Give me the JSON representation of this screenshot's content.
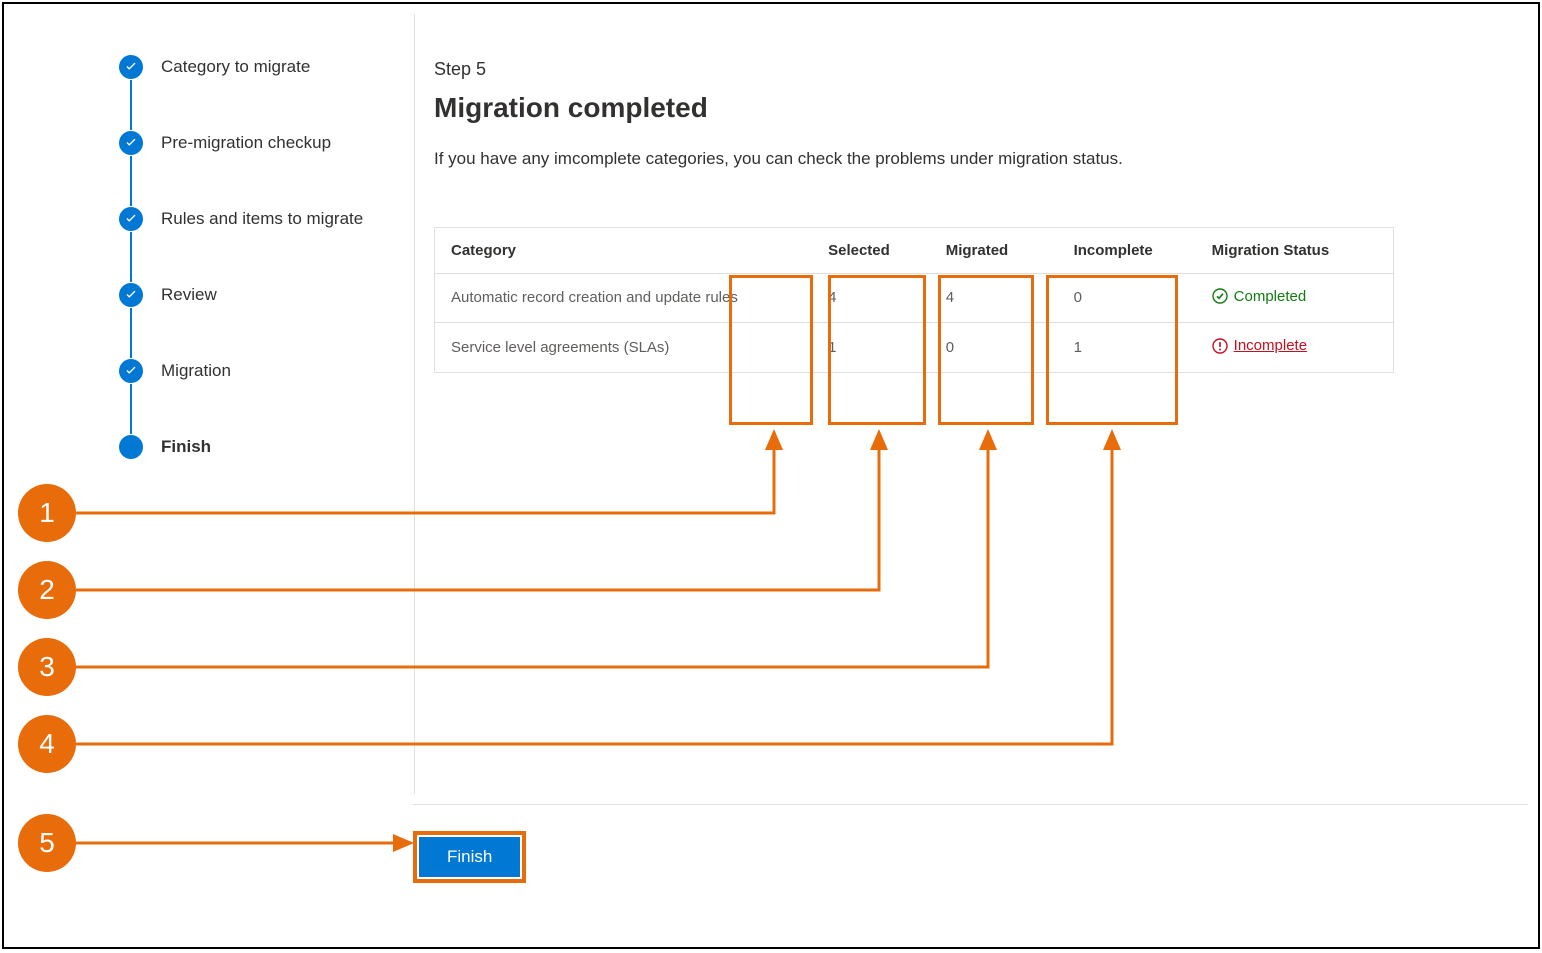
{
  "colors": {
    "accent": "#0078d4",
    "callout": "#e86c0a",
    "success": "#107c10",
    "error": "#c50f1f"
  },
  "stepper": {
    "items": [
      {
        "label": "Category to migrate",
        "state": "done"
      },
      {
        "label": "Pre-migration checkup",
        "state": "done"
      },
      {
        "label": "Rules and items to migrate",
        "state": "done"
      },
      {
        "label": "Review",
        "state": "done"
      },
      {
        "label": "Migration",
        "state": "done"
      },
      {
        "label": "Finish",
        "state": "current"
      }
    ]
  },
  "main": {
    "step_label": "Step 5",
    "title": "Migration completed",
    "desc": "If you have any imcomplete categories, you can check the problems under migration status."
  },
  "table": {
    "headers": {
      "category": "Category",
      "selected": "Selected",
      "migrated": "Migrated",
      "incomplete": "Incomplete",
      "status": "Migration Status"
    },
    "rows": [
      {
        "category": "Automatic record creation and update rules",
        "selected": "4",
        "migrated": "4",
        "incomplete": "0",
        "status_kind": "completed",
        "status_text": "Completed"
      },
      {
        "category": "Service level agreements (SLAs)",
        "selected": "1",
        "migrated": "0",
        "incomplete": "1",
        "status_kind": "incomplete",
        "status_text": "Incomplete"
      }
    ]
  },
  "footer": {
    "finish_label": "Finish"
  },
  "callouts": [
    "1",
    "2",
    "3",
    "4",
    "5"
  ]
}
